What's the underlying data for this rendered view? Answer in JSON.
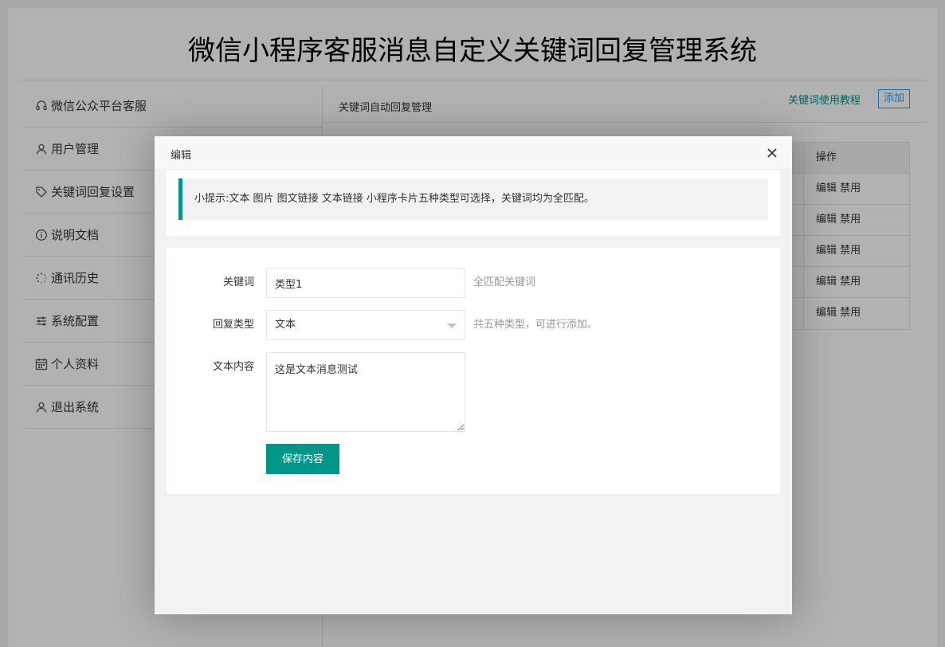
{
  "app": {
    "title": "微信小程序客服消息自定义关键词回复管理系统"
  },
  "sidebar": {
    "items": [
      {
        "label": "微信公众平台客服",
        "icon": "headset-icon"
      },
      {
        "label": "用户管理",
        "icon": "user-icon"
      },
      {
        "label": "关键词回复设置",
        "icon": "tag-icon"
      },
      {
        "label": "说明文档",
        "icon": "info-icon"
      },
      {
        "label": "通讯历史",
        "icon": "loading-icon"
      },
      {
        "label": "系统配置",
        "icon": "sliders-icon"
      },
      {
        "label": "个人资料",
        "icon": "calendar-icon"
      },
      {
        "label": "退出系统",
        "icon": "user-icon"
      }
    ]
  },
  "main": {
    "title": "关键词自动回复管理",
    "tutorial_link": "关键词使用教程",
    "add_button": "添加",
    "table": {
      "op_header": "操作",
      "rows": [
        {
          "edit": "编辑",
          "disable": "禁用"
        },
        {
          "edit": "编辑",
          "disable": "禁用"
        },
        {
          "edit": "编辑",
          "disable": "禁用"
        },
        {
          "edit": "编辑",
          "disable": "禁用"
        },
        {
          "edit": "编辑",
          "disable": "禁用"
        }
      ]
    }
  },
  "modal": {
    "title": "编辑",
    "tip": "小提示:文本 图片 图文链接 文本链接 小程序卡片五种类型可选择，关键词均为全匹配。",
    "form": {
      "keyword_label": "关键词",
      "keyword_value": "类型1",
      "keyword_hint": "全匹配关键词",
      "type_label": "回复类型",
      "type_value": "文本",
      "type_hint": "共五种类型，可进行添加。",
      "content_label": "文本内容",
      "content_value": "这是文本消息测试",
      "save_button": "保存内容"
    }
  },
  "colors": {
    "accent": "#009688",
    "link_blue": "#1e9fff"
  }
}
